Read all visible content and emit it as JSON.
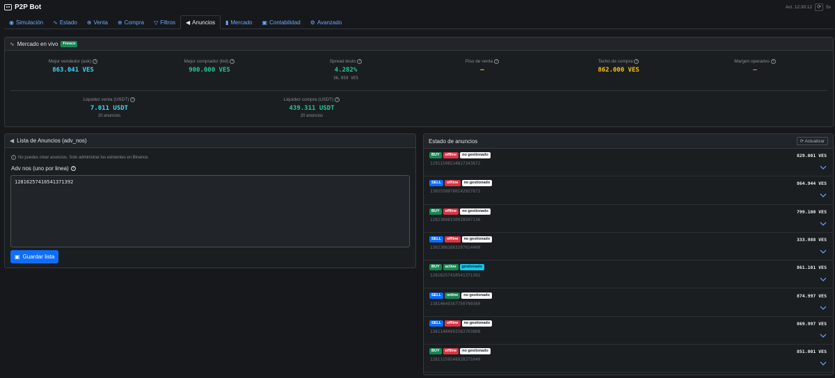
{
  "app": {
    "title": "P2P Bot",
    "last_update": "Act. 12:30:12",
    "top_right_text": "5s"
  },
  "tabs": [
    {
      "icon": "◉",
      "label": "Simulación",
      "active": false
    },
    {
      "icon": "∿",
      "label": "Estado",
      "active": false
    },
    {
      "icon": "⊕",
      "label": "Venta",
      "active": false
    },
    {
      "icon": "⊕",
      "label": "Compra",
      "active": false
    },
    {
      "icon": "▽",
      "label": "Filtros",
      "active": false
    },
    {
      "icon": "◀",
      "label": "Anuncios",
      "active": true
    },
    {
      "icon": "▮",
      "label": "Mercado",
      "active": false
    },
    {
      "icon": "▣",
      "label": "Contabilidad",
      "active": false
    },
    {
      "icon": "⚙",
      "label": "Avanzado",
      "active": false
    }
  ],
  "market": {
    "title": "Mercado en vivo",
    "badge": "Fresco",
    "best_ask": {
      "label": "Mejor vendedor (ask)",
      "value": "863.041 VES"
    },
    "best_bid": {
      "label": "Mejor comprador (bid)",
      "value": "900.000 VES"
    },
    "spread": {
      "label": "Spread bruto",
      "value": "4.282%",
      "sub": "36.959 VES"
    },
    "sell_floor": {
      "label": "Piso de venta",
      "value": "—"
    },
    "buy_ceiling": {
      "label": "Techo de compra",
      "value": "862.000 VES"
    },
    "margin": {
      "label": "Margen operativo",
      "value": "—"
    },
    "liq_sell": {
      "label": "Liquidez venta (USDT)",
      "value": "7.011 USDT",
      "sub": "20 anuncios"
    },
    "liq_buy": {
      "label": "Liquidez compra (USDT)",
      "value": "439.311 USDT",
      "sub": "20 anuncios"
    }
  },
  "ads_list": {
    "title": "Lista de Anuncios (adv_nos)",
    "note": "No puedes crear anuncios. Solo administrar los existentes en Binance.",
    "field_label": "Adv nos (uno por linea)",
    "field_value": "12816257410541371392",
    "save_label": "Guardar lista"
  },
  "status": {
    "title": "Estado de anuncios",
    "refresh_label": "Actualizar",
    "rows": [
      {
        "side": "BUY",
        "state": "offline",
        "managed": "no gestionado",
        "adv": "12911508534827343872",
        "price": "829.001 VES"
      },
      {
        "side": "SELL",
        "state": "offline",
        "managed": "no gestionado",
        "adv": "13025589780142927872",
        "price": "864.944 VES"
      },
      {
        "side": "BUY",
        "state": "offline",
        "managed": "no gestionado",
        "adv": "12823098330028507136",
        "price": "799.100 VES"
      },
      {
        "side": "SELL",
        "state": "offline",
        "managed": "no gestionado",
        "adv": "13023081663207014400",
        "price": "333.988 VES"
      },
      {
        "side": "BUY",
        "state": "activo",
        "managed": "gestionado",
        "adv": "12816257410541371392",
        "price": "861.101 VES"
      },
      {
        "side": "SELL",
        "state": "online",
        "managed": "no gestionado",
        "adv": "13814649367750799360",
        "price": "874.997 VES"
      },
      {
        "side": "SELL",
        "state": "offline",
        "managed": "no gestionado",
        "adv": "13811404992563703808",
        "price": "869.997 VES"
      },
      {
        "side": "BUY",
        "state": "offline",
        "managed": "no gestionado",
        "adv": "12811159548828375040",
        "price": "851.001 VES"
      }
    ]
  },
  "colors": {
    "buy": "#198754",
    "sell": "#0d6efd",
    "offline": "#dc3545",
    "online": "#198754",
    "activo": "#198754",
    "gestionado": "#0dcaf0",
    "no_gestionado": "#f8f9fa"
  }
}
